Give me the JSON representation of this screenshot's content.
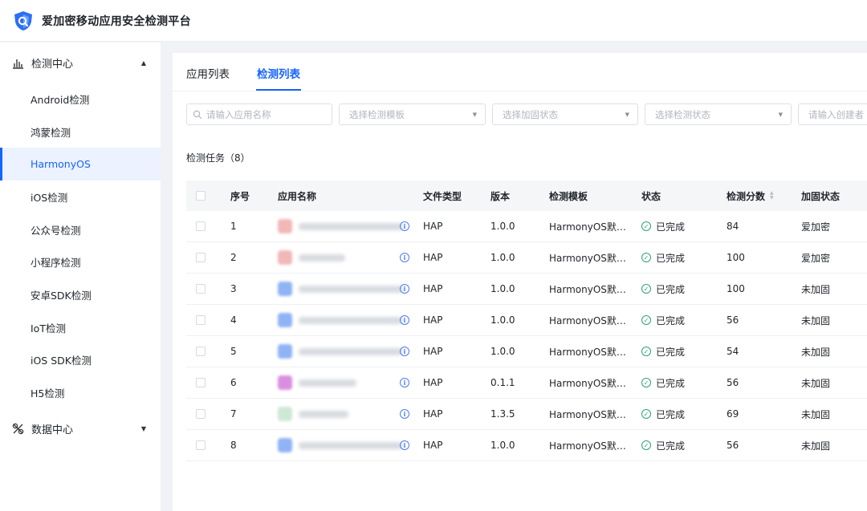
{
  "app": {
    "title": "爱加密移动应用安全检测平台"
  },
  "sidebar": {
    "group_detect": "检测中心",
    "items": [
      {
        "label": "Android检测",
        "active": false
      },
      {
        "label": "鸿蒙检测",
        "active": false
      },
      {
        "label": "HarmonyOS",
        "active": true
      },
      {
        "label": "iOS检测",
        "active": false
      },
      {
        "label": "公众号检测",
        "active": false
      },
      {
        "label": "小程序检测",
        "active": false
      },
      {
        "label": "安卓SDK检测",
        "active": false
      },
      {
        "label": "IoT检测",
        "active": false
      },
      {
        "label": "iOS SDK检测",
        "active": false
      },
      {
        "label": "H5检测",
        "active": false
      }
    ],
    "group_data": "数据中心"
  },
  "tabs": {
    "app_list": "应用列表",
    "detect_list": "检测列表"
  },
  "filters": {
    "app_name_placeholder": "请输入应用名称",
    "template_placeholder": "选择检测模板",
    "harden_placeholder": "选择加固状态",
    "status_placeholder": "选择检测状态",
    "creator_placeholder": "请输入创建者"
  },
  "section": {
    "title": "检测任务（8）"
  },
  "table": {
    "headers": {
      "index": "序号",
      "app_name": "应用名称",
      "file_type": "文件类型",
      "version": "版本",
      "template": "检测模板",
      "status": "状态",
      "score": "检测分数",
      "harden": "加固状态"
    },
    "rows": [
      {
        "index": "1",
        "file_type": "HAP",
        "version": "1.0.0",
        "template": "HarmonyOS默…",
        "status": "已完成",
        "score": "84",
        "harden": "爱加密",
        "thumb_color": "#f2b8b8"
      },
      {
        "index": "2",
        "file_type": "HAP",
        "version": "1.0.0",
        "template": "HarmonyOS默…",
        "status": "已完成",
        "score": "100",
        "harden": "爱加密",
        "thumb_color": "#f2b8b8"
      },
      {
        "index": "3",
        "file_type": "HAP",
        "version": "1.0.0",
        "template": "HarmonyOS默…",
        "status": "已完成",
        "score": "100",
        "harden": "未加固",
        "thumb_color": "#8fb3f5"
      },
      {
        "index": "4",
        "file_type": "HAP",
        "version": "1.0.0",
        "template": "HarmonyOS默…",
        "status": "已完成",
        "score": "56",
        "harden": "未加固",
        "thumb_color": "#8fb3f5"
      },
      {
        "index": "5",
        "file_type": "HAP",
        "version": "1.0.0",
        "template": "HarmonyOS默…",
        "status": "已完成",
        "score": "54",
        "harden": "未加固",
        "thumb_color": "#8fb3f5"
      },
      {
        "index": "6",
        "file_type": "HAP",
        "version": "0.1.1",
        "template": "HarmonyOS默…",
        "status": "已完成",
        "score": "56",
        "harden": "未加固",
        "thumb_color": "#d98ee0"
      },
      {
        "index": "7",
        "file_type": "HAP",
        "version": "1.3.5",
        "template": "HarmonyOS默…",
        "status": "已完成",
        "score": "69",
        "harden": "未加固",
        "thumb_color": "#cfe8d6"
      },
      {
        "index": "8",
        "file_type": "HAP",
        "version": "1.0.0",
        "template": "HarmonyOS默…",
        "status": "已完成",
        "score": "56",
        "harden": "未加固",
        "thumb_color": "#8fb3f5"
      }
    ]
  },
  "colors": {
    "accent": "#1664ff",
    "success": "#2ba471",
    "info": "#4c7cf0"
  }
}
